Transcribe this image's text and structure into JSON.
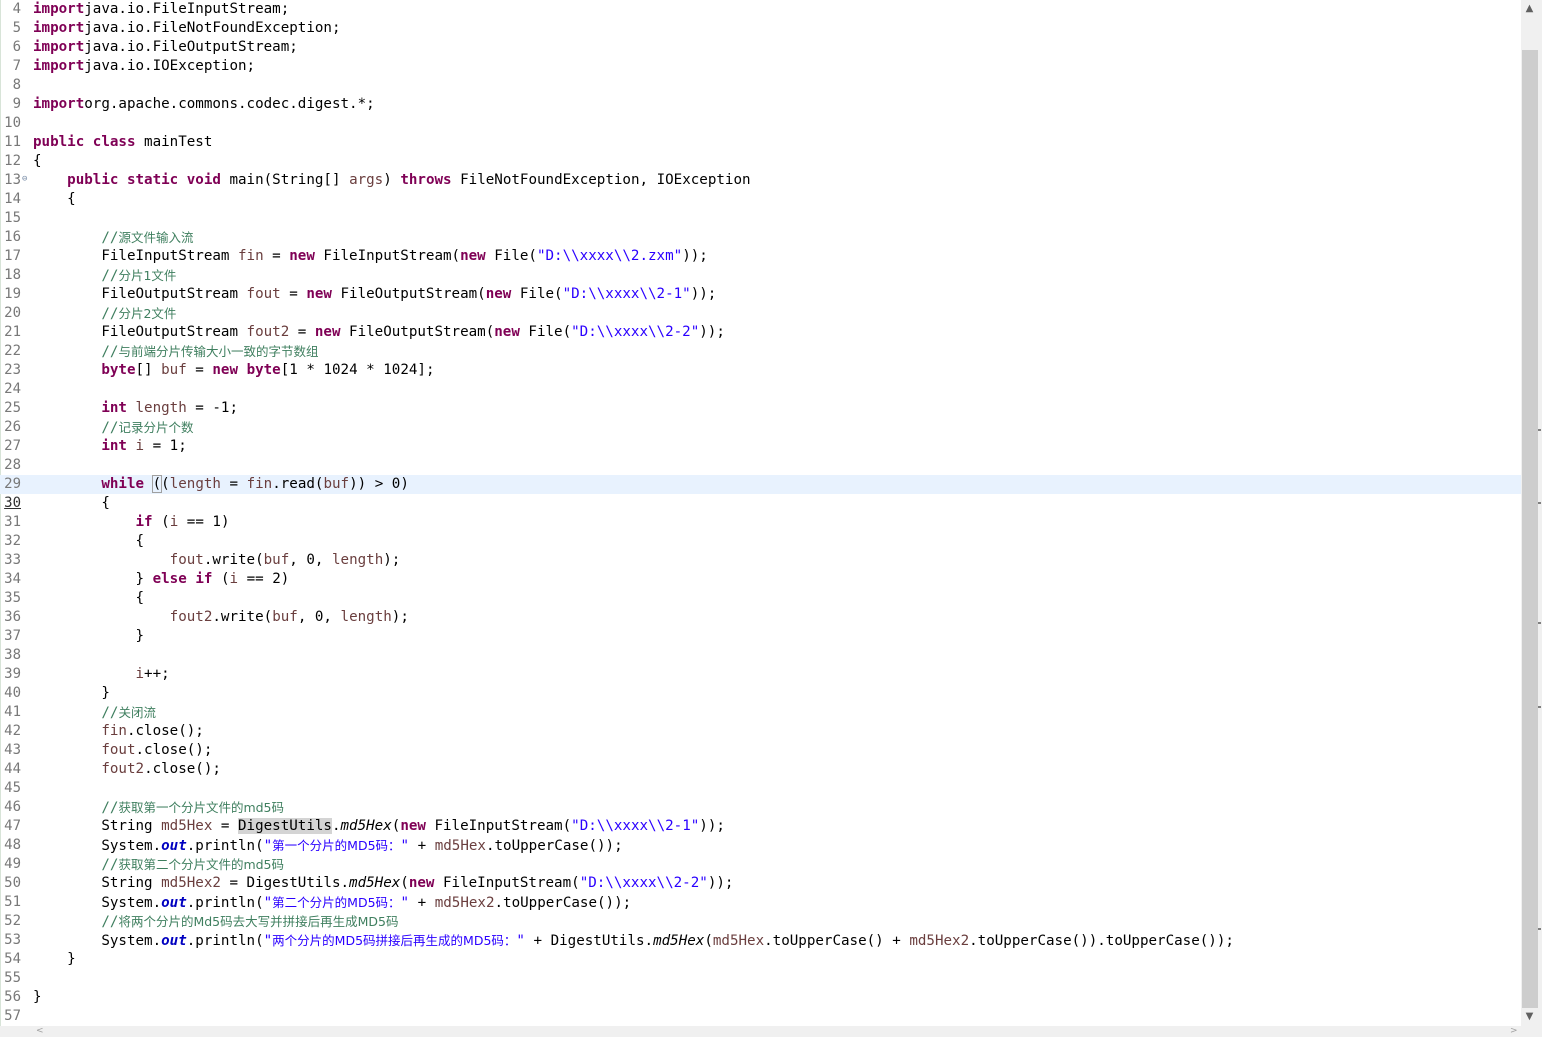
{
  "editor": {
    "lines": [
      {
        "n": "4",
        "t": [
          [
            "kw",
            "import"
          ],
          [
            "",
            "java.io.FileInputStream;"
          ]
        ]
      },
      {
        "n": "5",
        "t": [
          [
            "kw",
            "import"
          ],
          [
            "",
            "java.io.FileNotFoundException;"
          ]
        ]
      },
      {
        "n": "6",
        "t": [
          [
            "kw",
            "import"
          ],
          [
            "",
            "java.io.FileOutputStream;"
          ]
        ]
      },
      {
        "n": "7",
        "t": [
          [
            "kw",
            "import"
          ],
          [
            "",
            "java.io.IOException;"
          ]
        ]
      },
      {
        "n": "8",
        "t": []
      },
      {
        "n": "9",
        "t": [
          [
            "kw",
            "import"
          ],
          [
            "",
            "org.apache.commons.codec.digest.*;"
          ]
        ]
      },
      {
        "n": "10",
        "t": []
      },
      {
        "n": "11",
        "t": [
          [
            "kw",
            "public"
          ],
          [
            "",
            " "
          ],
          [
            "kw",
            "class"
          ],
          [
            "",
            " mainTest"
          ]
        ]
      },
      {
        "n": "12",
        "t": [
          [
            "",
            "{"
          ]
        ]
      },
      {
        "n": "13",
        "t": [
          [
            "",
            "    "
          ],
          [
            "kw",
            "public"
          ],
          [
            "",
            " "
          ],
          [
            "kw",
            "static"
          ],
          [
            "",
            " "
          ],
          [
            "kw",
            "void"
          ],
          [
            "",
            " main(String[] "
          ],
          [
            "var",
            "args"
          ],
          [
            "",
            ") "
          ],
          [
            "kw",
            "throws"
          ],
          [
            "",
            " FileNotFoundException, IOException"
          ]
        ],
        "fold": true
      },
      {
        "n": "14",
        "t": [
          [
            "",
            "    {"
          ]
        ]
      },
      {
        "n": "15",
        "t": []
      },
      {
        "n": "16",
        "t": [
          [
            "",
            "        "
          ],
          [
            "cm",
            "//"
          ],
          [
            "cm cjk",
            "源文件输入流"
          ]
        ]
      },
      {
        "n": "17",
        "t": [
          [
            "",
            "        FileInputStream "
          ],
          [
            "var",
            "fin"
          ],
          [
            "",
            " = "
          ],
          [
            "kw",
            "new"
          ],
          [
            "",
            " FileInputStream("
          ],
          [
            "kw",
            "new"
          ],
          [
            "",
            " File("
          ],
          [
            "str",
            "\"D:\\\\xxxx\\\\2.zxm\""
          ],
          [
            "",
            "));"
          ]
        ]
      },
      {
        "n": "18",
        "t": [
          [
            "",
            "        "
          ],
          [
            "cm",
            "//"
          ],
          [
            "cm cjk",
            "分片1文件"
          ]
        ]
      },
      {
        "n": "19",
        "t": [
          [
            "",
            "        FileOutputStream "
          ],
          [
            "var",
            "fout"
          ],
          [
            "",
            " = "
          ],
          [
            "kw",
            "new"
          ],
          [
            "",
            " FileOutputStream("
          ],
          [
            "kw",
            "new"
          ],
          [
            "",
            " File("
          ],
          [
            "str",
            "\"D:\\\\xxxx\\\\2-1\""
          ],
          [
            "",
            "));"
          ]
        ]
      },
      {
        "n": "20",
        "t": [
          [
            "",
            "        "
          ],
          [
            "cm",
            "//"
          ],
          [
            "cm cjk",
            "分片2文件"
          ]
        ]
      },
      {
        "n": "21",
        "t": [
          [
            "",
            "        FileOutputStream "
          ],
          [
            "var",
            "fout2"
          ],
          [
            "",
            " = "
          ],
          [
            "kw",
            "new"
          ],
          [
            "",
            " FileOutputStream("
          ],
          [
            "kw",
            "new"
          ],
          [
            "",
            " File("
          ],
          [
            "str",
            "\"D:\\\\xxxx\\\\2-2\""
          ],
          [
            "",
            "));"
          ]
        ]
      },
      {
        "n": "22",
        "t": [
          [
            "",
            "        "
          ],
          [
            "cm",
            "//"
          ],
          [
            "cm cjk",
            "与前端分片传输大小一致的字节数组"
          ]
        ]
      },
      {
        "n": "23",
        "t": [
          [
            "",
            "        "
          ],
          [
            "kw",
            "byte"
          ],
          [
            "",
            "[] "
          ],
          [
            "var",
            "buf"
          ],
          [
            "",
            " = "
          ],
          [
            "kw",
            "new"
          ],
          [
            "",
            " "
          ],
          [
            "kw",
            "byte"
          ],
          [
            "",
            "[1 * 1024 * 1024];"
          ]
        ]
      },
      {
        "n": "24",
        "t": []
      },
      {
        "n": "25",
        "t": [
          [
            "",
            "        "
          ],
          [
            "kw",
            "int"
          ],
          [
            "",
            " "
          ],
          [
            "var",
            "length"
          ],
          [
            "",
            " = -1;"
          ]
        ]
      },
      {
        "n": "26",
        "t": [
          [
            "",
            "        "
          ],
          [
            "cm",
            "//"
          ],
          [
            "cm cjk",
            "记录分片个数"
          ]
        ]
      },
      {
        "n": "27",
        "t": [
          [
            "",
            "        "
          ],
          [
            "kw",
            "int"
          ],
          [
            "",
            " "
          ],
          [
            "var",
            "i"
          ],
          [
            "",
            " = 1;"
          ]
        ]
      },
      {
        "n": "28",
        "t": []
      },
      {
        "n": "29",
        "t": [
          [
            "",
            "        "
          ],
          [
            "kw",
            "while"
          ],
          [
            "",
            " "
          ],
          [
            "br",
            "("
          ],
          [
            "",
            "("
          ],
          [
            "var",
            "length"
          ],
          [
            "",
            " = "
          ],
          [
            "var",
            "fin"
          ],
          [
            "",
            ".read("
          ],
          [
            "var",
            "buf"
          ],
          [
            "",
            ")) > 0)"
          ]
        ],
        "current": true
      },
      {
        "n": "30",
        "t": [
          [
            "",
            "        {"
          ]
        ],
        "curln": true
      },
      {
        "n": "31",
        "t": [
          [
            "",
            "            "
          ],
          [
            "kw",
            "if"
          ],
          [
            "",
            " ("
          ],
          [
            "var",
            "i"
          ],
          [
            "",
            " == 1)"
          ]
        ]
      },
      {
        "n": "32",
        "t": [
          [
            "",
            "            {"
          ]
        ]
      },
      {
        "n": "33",
        "t": [
          [
            "",
            "                "
          ],
          [
            "var",
            "fout"
          ],
          [
            "",
            ".write("
          ],
          [
            "var",
            "buf"
          ],
          [
            "",
            ", 0, "
          ],
          [
            "var",
            "length"
          ],
          [
            "",
            ");"
          ]
        ]
      },
      {
        "n": "34",
        "t": [
          [
            "",
            "            } "
          ],
          [
            "kw",
            "else"
          ],
          [
            "",
            " "
          ],
          [
            "kw",
            "if"
          ],
          [
            "",
            " ("
          ],
          [
            "var",
            "i"
          ],
          [
            "",
            " == 2)"
          ]
        ]
      },
      {
        "n": "35",
        "t": [
          [
            "",
            "            {"
          ]
        ]
      },
      {
        "n": "36",
        "t": [
          [
            "",
            "                "
          ],
          [
            "var",
            "fout2"
          ],
          [
            "",
            ".write("
          ],
          [
            "var",
            "buf"
          ],
          [
            "",
            ", 0, "
          ],
          [
            "var",
            "length"
          ],
          [
            "",
            ");"
          ]
        ]
      },
      {
        "n": "37",
        "t": [
          [
            "",
            "            }"
          ]
        ]
      },
      {
        "n": "38",
        "t": []
      },
      {
        "n": "39",
        "t": [
          [
            "",
            "            "
          ],
          [
            "var",
            "i"
          ],
          [
            "",
            "++;"
          ]
        ]
      },
      {
        "n": "40",
        "t": [
          [
            "",
            "        }"
          ]
        ]
      },
      {
        "n": "41",
        "t": [
          [
            "",
            "        "
          ],
          [
            "cm",
            "//"
          ],
          [
            "cm cjk",
            "关闭流"
          ]
        ]
      },
      {
        "n": "42",
        "t": [
          [
            "",
            "        "
          ],
          [
            "var",
            "fin"
          ],
          [
            "",
            ".close();"
          ]
        ]
      },
      {
        "n": "43",
        "t": [
          [
            "",
            "        "
          ],
          [
            "var",
            "fout"
          ],
          [
            "",
            ".close();"
          ]
        ]
      },
      {
        "n": "44",
        "t": [
          [
            "",
            "        "
          ],
          [
            "var",
            "fout2"
          ],
          [
            "",
            ".close();"
          ]
        ]
      },
      {
        "n": "45",
        "t": []
      },
      {
        "n": "46",
        "t": [
          [
            "",
            "        "
          ],
          [
            "cm",
            "//"
          ],
          [
            "cm cjk",
            "获取第一个分片文件的md5码"
          ]
        ]
      },
      {
        "n": "47",
        "t": [
          [
            "",
            "        String "
          ],
          [
            "var",
            "md5Hex"
          ],
          [
            "",
            " = "
          ],
          [
            "hl",
            "DigestUtils"
          ],
          [
            "",
            "."
          ],
          [
            "sm",
            "md5Hex"
          ],
          [
            "",
            "("
          ],
          [
            "kw",
            "new"
          ],
          [
            "",
            " FileInputStream("
          ],
          [
            "str",
            "\"D:\\\\xxxx\\\\2-1\""
          ],
          [
            "",
            "));"
          ]
        ]
      },
      {
        "n": "48",
        "t": [
          [
            "",
            "        System."
          ],
          [
            "fld",
            "out"
          ],
          [
            "",
            ".println("
          ],
          [
            "str",
            "\""
          ],
          [
            "str cjk",
            "第一个分片的MD5码："
          ],
          [
            "str",
            "\""
          ],
          [
            "",
            " + "
          ],
          [
            "var",
            "md5Hex"
          ],
          [
            "",
            ".toUpperCase());"
          ]
        ]
      },
      {
        "n": "49",
        "t": [
          [
            "",
            "        "
          ],
          [
            "cm",
            "//"
          ],
          [
            "cm cjk",
            "获取第二个分片文件的md5码"
          ]
        ]
      },
      {
        "n": "50",
        "t": [
          [
            "",
            "        String "
          ],
          [
            "var",
            "md5Hex2"
          ],
          [
            "",
            " = DigestUtils."
          ],
          [
            "sm",
            "md5Hex"
          ],
          [
            "",
            "("
          ],
          [
            "kw",
            "new"
          ],
          [
            "",
            " FileInputStream("
          ],
          [
            "str",
            "\"D:\\\\xxxx\\\\2-2\""
          ],
          [
            "",
            "));"
          ]
        ]
      },
      {
        "n": "51",
        "t": [
          [
            "",
            "        System."
          ],
          [
            "fld",
            "out"
          ],
          [
            "",
            ".println("
          ],
          [
            "str",
            "\""
          ],
          [
            "str cjk",
            "第二个分片的MD5码："
          ],
          [
            "str",
            "\""
          ],
          [
            "",
            " + "
          ],
          [
            "var",
            "md5Hex2"
          ],
          [
            "",
            ".toUpperCase());"
          ]
        ]
      },
      {
        "n": "52",
        "t": [
          [
            "",
            "        "
          ],
          [
            "cm",
            "//"
          ],
          [
            "cm cjk",
            "将两个分片的Md5码去大写并拼接后再生成MD5码"
          ]
        ]
      },
      {
        "n": "53",
        "t": [
          [
            "",
            "        System."
          ],
          [
            "fld",
            "out"
          ],
          [
            "",
            ".println("
          ],
          [
            "str",
            "\""
          ],
          [
            "str cjk",
            "两个分片的MD5码拼接后再生成的MD5码："
          ],
          [
            "str",
            "\""
          ],
          [
            "",
            " + DigestUtils."
          ],
          [
            "sm",
            "md5Hex"
          ],
          [
            "",
            "("
          ],
          [
            "var",
            "md5Hex"
          ],
          [
            "",
            ".toUpperCase() + "
          ],
          [
            "var",
            "md5Hex2"
          ],
          [
            "",
            ".toUpperCase()).toUpperCase());"
          ]
        ]
      },
      {
        "n": "54",
        "t": [
          [
            "",
            "    }"
          ]
        ]
      },
      {
        "n": "55",
        "t": []
      },
      {
        "n": "56",
        "t": [
          [
            "",
            "}"
          ]
        ]
      },
      {
        "n": "57",
        "t": []
      }
    ]
  },
  "scrollbar": {
    "up_icon": "▲",
    "down_icon": "▼",
    "left_icon": "<",
    "right_icon": ">"
  }
}
